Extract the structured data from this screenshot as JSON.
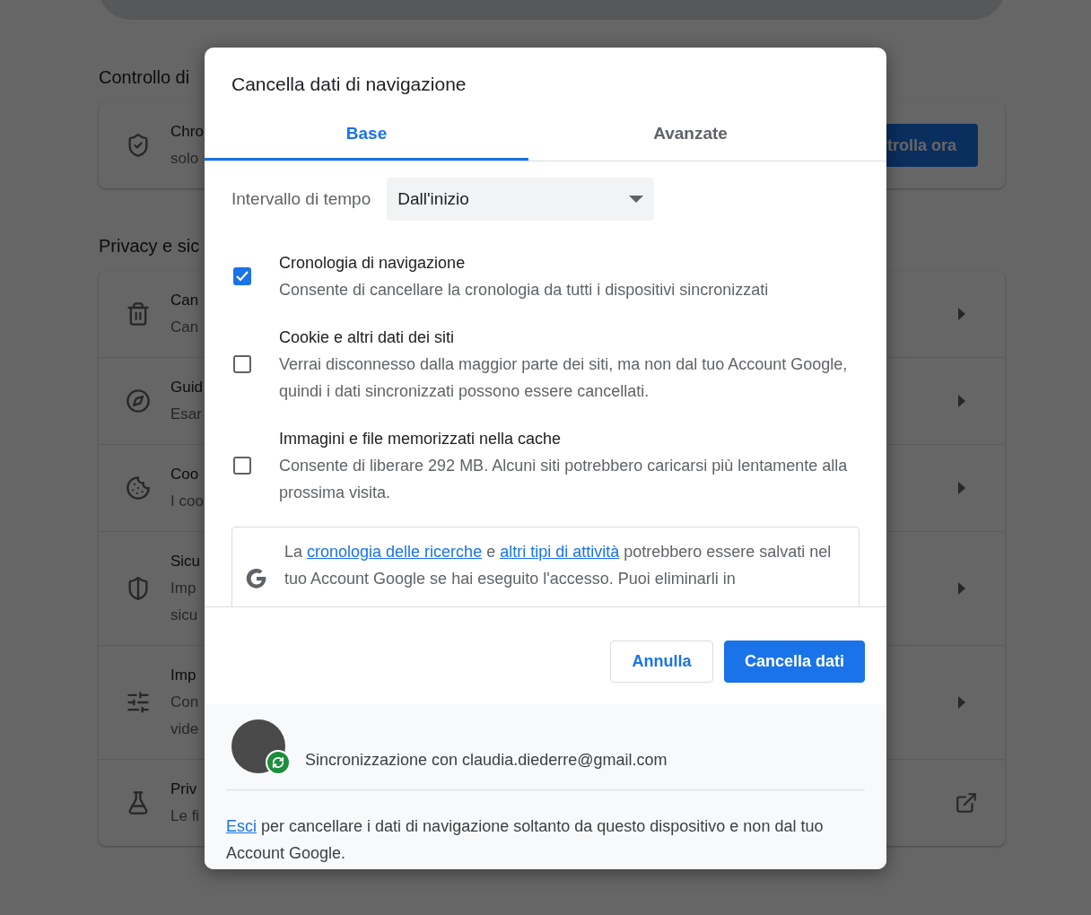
{
  "sections": [
    {
      "title": "Controllo di",
      "rows": [
        {
          "kind": "action",
          "title": "Chro",
          "lines": [
            "solo"
          ],
          "action": "trolla ora"
        }
      ]
    },
    {
      "title": "Privacy e sic",
      "rows": [
        {
          "kind": "page",
          "title": "Can",
          "lines": [
            "Can"
          ]
        },
        {
          "kind": "page",
          "title": "Guid",
          "lines": [
            "Esar"
          ]
        },
        {
          "kind": "page",
          "title": "Coo",
          "lines": [
            "I coo"
          ]
        },
        {
          "kind": "page",
          "title": "Sicu",
          "lines": [
            "Imp",
            "sicu"
          ]
        },
        {
          "kind": "page",
          "title": "Imp",
          "lines": [
            "Con",
            "vide"
          ]
        },
        {
          "kind": "external",
          "title": "Priv",
          "lines": [
            "Le fi"
          ]
        }
      ]
    }
  ],
  "dialog": {
    "title": "Cancella dati di navigazione",
    "tabs": [
      {
        "label": "Base",
        "selected": true
      },
      {
        "label": "Avanzate",
        "selected": false
      }
    ],
    "time_range": {
      "label": "Intervallo di tempo",
      "value": "Dall'inizio"
    },
    "options": [
      {
        "label": "Cronologia di navigazione",
        "description": "Consente di cancellare la cronologia da tutti i dispositivi sincronizzati",
        "checked": true
      },
      {
        "label": "Cookie e altri dati dei siti",
        "description": "Verrai disconnesso dalla maggior parte dei siti, ma non dal tuo Account Google, quindi i dati sincronizzati possono essere cancellati.",
        "checked": false
      },
      {
        "label": "Immagini e file memorizzati nella cache",
        "description": "Consente di liberare 292 MB. Alcuni siti potrebbero caricarsi più lentamente alla prossima visita.",
        "checked": false
      }
    ],
    "info": [
      {
        "text": "La "
      },
      {
        "text": "cronologia delle ricerche",
        "link": true
      },
      {
        "text": " e "
      },
      {
        "text": "altri tipi di attività",
        "link": true
      },
      {
        "text": " potrebbero essere salvati nel tuo Account Google se hai eseguito l'accesso. Puoi eliminarli in"
      }
    ],
    "buttons": [
      {
        "label": "Annulla",
        "kind": "secondary"
      },
      {
        "label": "Cancella dati",
        "kind": "primary"
      }
    ],
    "account": {
      "sync_text": "Sincronizzazione con claudia.diederre@gmail.com"
    },
    "signout": [
      {
        "text": "Esci",
        "link": true
      },
      {
        "text": " per cancellare i dati di navigazione soltanto da questo dispositivo e non dal tuo Account Google."
      }
    ]
  }
}
